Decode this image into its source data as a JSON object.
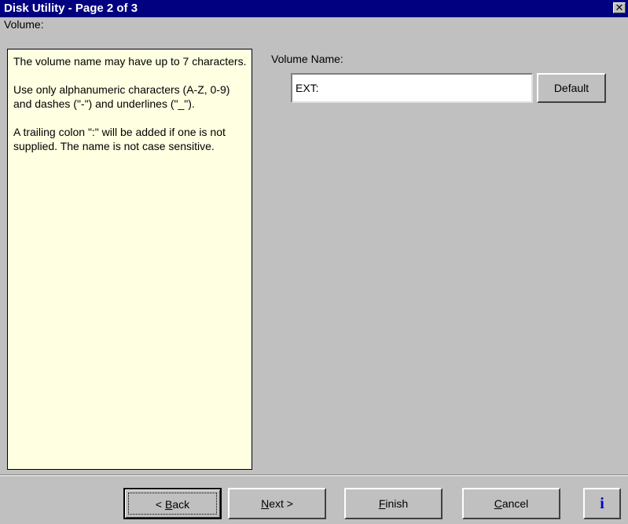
{
  "window": {
    "title": "Disk Utility - Page 2 of 3",
    "close_glyph": "✕"
  },
  "section": {
    "label": "Volume:"
  },
  "help": {
    "paragraphs": [
      "The volume name may have up to 7 characters.",
      "Use only alphanumeric characters (A-Z, 0-9) and dashes (\"-\") and underlines (\"_\").",
      "A trailing colon \":\" will be added if one is not supplied.  The name is not case sensitive."
    ]
  },
  "form": {
    "volume_name_label": "Volume Name:",
    "volume_name_value": "EXT:",
    "default_label": "Default"
  },
  "footer": {
    "back": {
      "prefix": "< ",
      "key": "B",
      "rest": "ack"
    },
    "next": {
      "key": "N",
      "rest": "ext >"
    },
    "finish": {
      "key": "F",
      "rest": "inish"
    },
    "cancel": {
      "key": "C",
      "rest": "ancel"
    },
    "info_glyph": "i"
  },
  "colors": {
    "titlebar": "#000080",
    "help_background": "#ffffe1",
    "window_background": "#c0c0c0",
    "info_icon": "#0000c8"
  },
  "icons": {
    "close": "close-icon",
    "info": "info-icon"
  }
}
